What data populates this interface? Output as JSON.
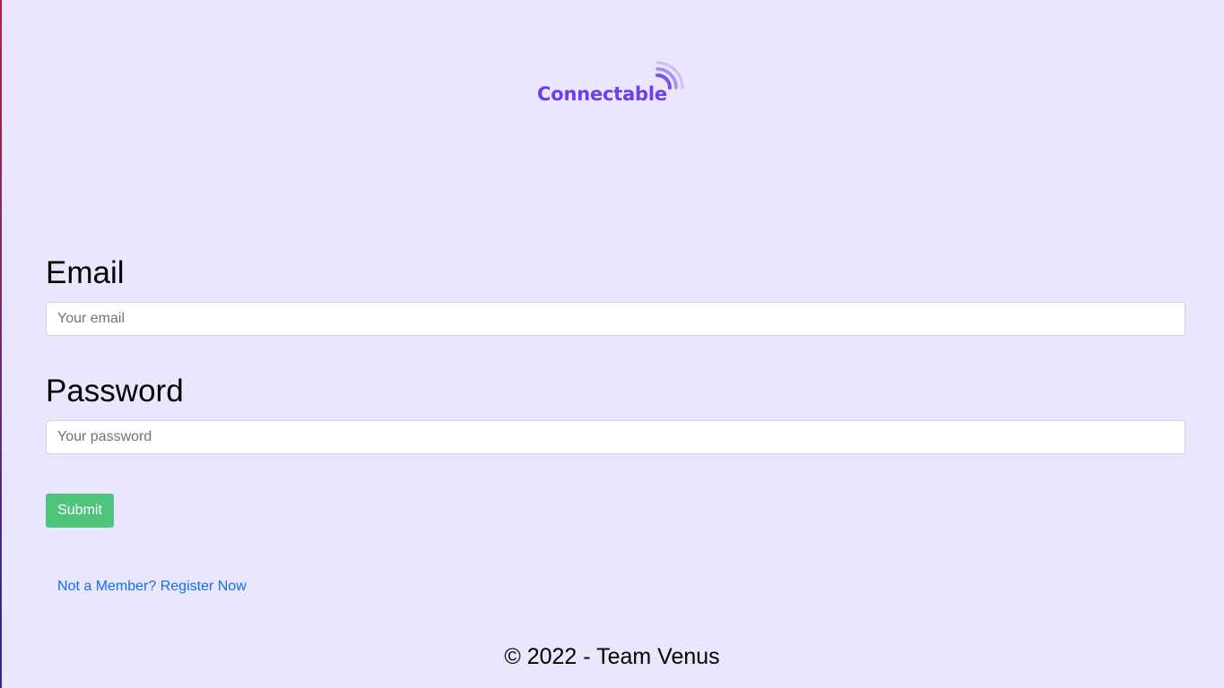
{
  "brand": {
    "name": "Connectable",
    "logo_icon": "wifi-waves-icon",
    "color": "#6d3ef0"
  },
  "form": {
    "email": {
      "label": "Email",
      "placeholder": "Your email",
      "value": ""
    },
    "password": {
      "label": "Password",
      "placeholder": "Your password",
      "value": ""
    },
    "submit_label": "Submit",
    "submit_color": "#4fc47c"
  },
  "register_link": "Not a Member? Register Now",
  "footer": "© 2022 - Team Venus",
  "colors": {
    "background": "#e9e6fd",
    "link": "#0d6efd"
  }
}
